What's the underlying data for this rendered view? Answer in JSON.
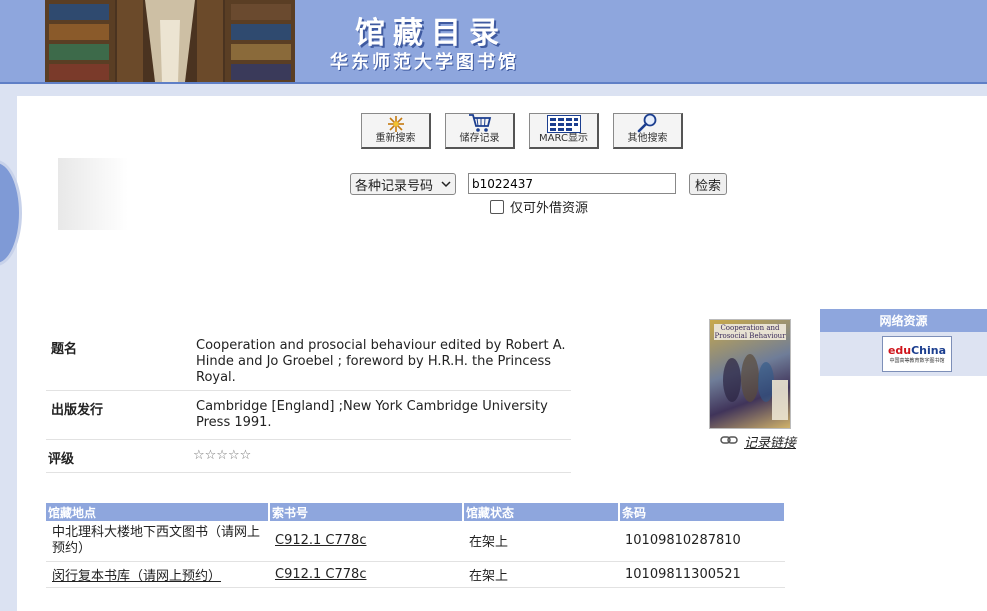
{
  "banner": {
    "title": "馆藏目录",
    "subtitle": "华东师范大学图书馆"
  },
  "toolbar": {
    "buttons": [
      {
        "label": "重新搜索",
        "icon": "sparkle-icon"
      },
      {
        "label": "储存记录",
        "icon": "cart-icon"
      },
      {
        "label": "MARC显示",
        "icon": "marc-grid-icon"
      },
      {
        "label": "其他搜索",
        "icon": "magnifier-icon"
      }
    ]
  },
  "search": {
    "type_selected": "各种记录号码",
    "query": "b1022437",
    "submit_label": "检索",
    "checkbox_label": "仅可外借资源",
    "checkbox_checked": false
  },
  "record": {
    "title_label": "题名",
    "title_value": "Cooperation and prosocial behaviour edited by Robert A. Hinde and Jo Groebel ; foreword by H.R.H. the Princess Royal.",
    "pub_label": "出版发行",
    "pub_value": "Cambridge [England] ;New York Cambridge University Press 1991.",
    "rating_label": "评级",
    "rating_stars": "☆☆☆☆☆",
    "rating_value": 0,
    "rating_max": 5
  },
  "cover": {
    "text": "Cooperation and Prosocial Behaviour"
  },
  "record_link": {
    "label": "记录链接",
    "icon": "link-icon"
  },
  "side": {
    "header": "网络资源",
    "logo_main_a": "edu",
    "logo_main_b": "China",
    "logo_sub": "中国高等教育数字图书馆"
  },
  "holdings": {
    "headers": [
      "馆藏地点",
      "索书号",
      "馆藏状态",
      "条码"
    ],
    "rows": [
      {
        "location": "中北理科大楼地下西文图书（请网上预约）",
        "call": "C912.1 C778c",
        "status": "在架上",
        "barcode": "10109810287810"
      },
      {
        "location": "闵行复本书库（请网上预约）",
        "call": "C912.1 C778c",
        "status": "在架上",
        "barcode": "10109811300521"
      }
    ]
  },
  "colors": {
    "accent": "#8ea6dd",
    "accent_dark": "#5f7fc6",
    "side_bg": "#dde3f2"
  }
}
